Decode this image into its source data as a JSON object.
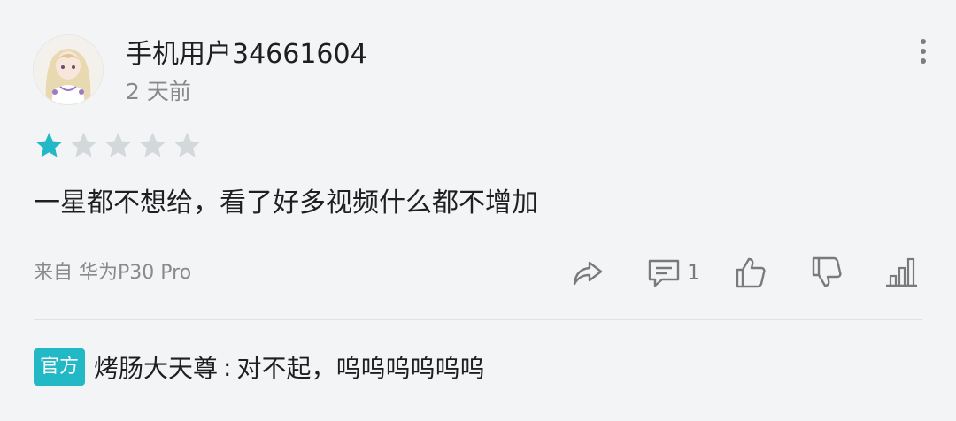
{
  "comment": {
    "username": "手机用户34661604",
    "time": "2 天前",
    "rating": 1,
    "rating_max": 5,
    "content": "一星都不想给，看了好多视频什么都不增加",
    "source": "来自 华为P30 Pro",
    "reply_count": "1"
  },
  "reply": {
    "badge": "官方",
    "author": "烤肠大天尊",
    "separator": ":",
    "text": "对不起，呜呜呜呜呜呜"
  },
  "colors": {
    "accent": "#22b8c6",
    "star_filled": "#22b8c6",
    "star_empty": "#d3d8db",
    "muted_text": "#8a8a8a",
    "icon": "#7a7a7a"
  },
  "icons": {
    "more": "more-vertical-icon",
    "share": "share-icon",
    "comment": "comment-icon",
    "like": "thumbs-up-icon",
    "dislike": "thumbs-down-icon",
    "stats": "bar-chart-icon"
  }
}
